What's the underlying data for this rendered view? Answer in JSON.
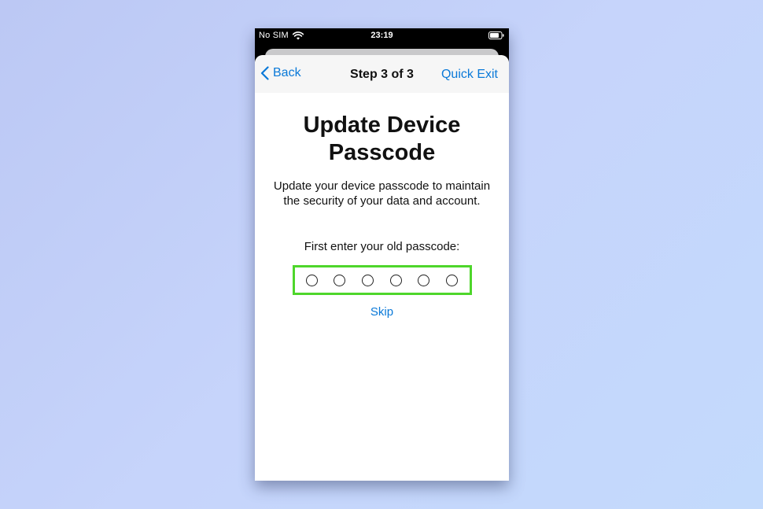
{
  "status_bar": {
    "carrier": "No SIM",
    "time": "23:19",
    "wifi_icon": "wifi-icon",
    "battery_icon": "battery-icon"
  },
  "nav": {
    "back_label": "Back",
    "title": "Step 3 of 3",
    "quick_exit_label": "Quick Exit",
    "accent_color": "#0a79d8"
  },
  "main": {
    "title": "Update Device Passcode",
    "description": "Update your device passcode to maintain the security of your data and account.",
    "prompt": "First enter your old passcode:",
    "passcode_length": 6,
    "passcode_entered": 0,
    "highlight_color": "#4ed62b",
    "skip_label": "Skip"
  }
}
